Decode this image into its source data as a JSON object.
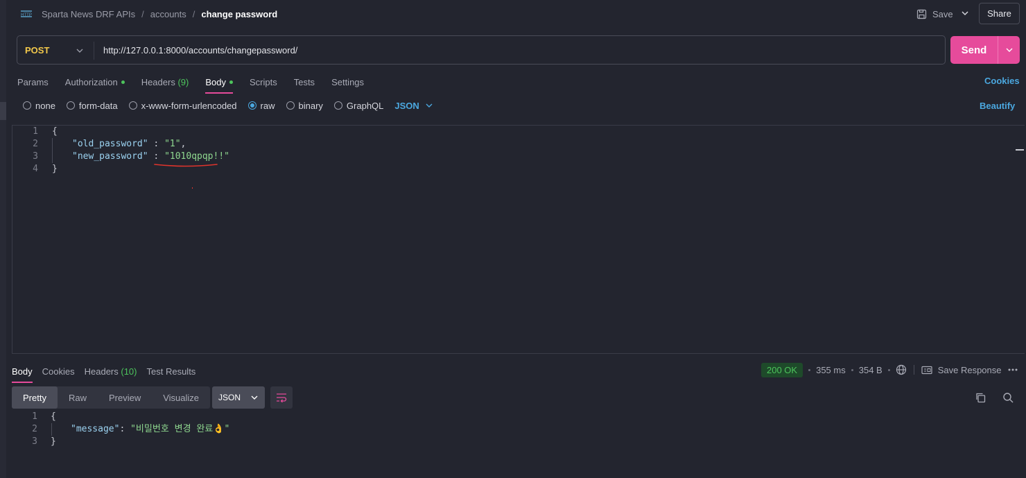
{
  "header": {
    "breadcrumb": [
      "Sparta News DRF APIs",
      "accounts"
    ],
    "current": "change password",
    "save_label": "Save",
    "share_label": "Share"
  },
  "request": {
    "method": "POST",
    "url": "http://127.0.0.1:8000/accounts/changepassword/",
    "send_label": "Send"
  },
  "tabs": {
    "params": "Params",
    "authorization": "Authorization",
    "headers": "Headers",
    "headers_count": "(9)",
    "body": "Body",
    "scripts": "Scripts",
    "tests": "Tests",
    "settings": "Settings",
    "cookies": "Cookies"
  },
  "body_types": {
    "none": "none",
    "form_data": "form-data",
    "urlencoded": "x-www-form-urlencoded",
    "raw": "raw",
    "binary": "binary",
    "graphql": "GraphQL",
    "format": "JSON",
    "beautify": "Beautify"
  },
  "request_body": {
    "line_numbers": [
      "1",
      "2",
      "3",
      "4"
    ],
    "open_brace": "{",
    "key1": "\"old_password\"",
    "val1": "\"1\"",
    "key2": "\"new_password\"",
    "val2": "\"1010qpqp!!\"",
    "close_brace": "}"
  },
  "response": {
    "tabs": {
      "body": "Body",
      "cookies": "Cookies",
      "headers": "Headers",
      "headers_count": "(10)",
      "test_results": "Test Results"
    },
    "status": "200 OK",
    "time": "355 ms",
    "size": "354 B",
    "save_response": "Save Response",
    "view_modes": [
      "Pretty",
      "Raw",
      "Preview",
      "Visualize"
    ],
    "format": "JSON",
    "line_numbers": [
      "1",
      "2",
      "3"
    ],
    "open_brace": "{",
    "key": "\"message\"",
    "value": "\"비밀번호 변경 완료👌\"",
    "close_brace": "}"
  },
  "colors": {
    "accent": "#e64b9b",
    "link": "#4ba8e0",
    "method": "#f3c94b",
    "success": "#4dc45c",
    "annotation": "#e0342c"
  }
}
